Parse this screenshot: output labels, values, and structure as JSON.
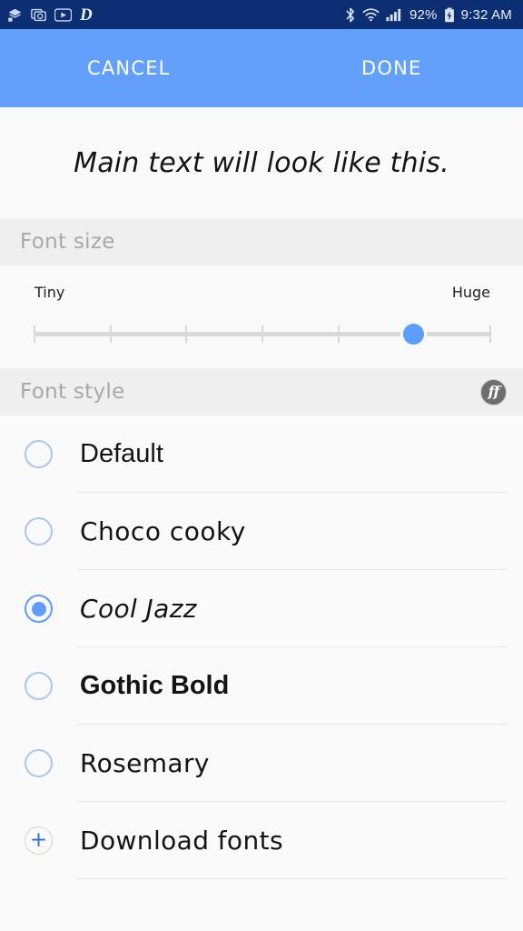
{
  "status_bar": {
    "background": "#0b2f72",
    "left_icons": [
      {
        "name": "downloads-stack-icon",
        "glyph": "☰"
      },
      {
        "name": "screenshot-capture-icon",
        "glyph": "▣"
      },
      {
        "name": "youtube-icon",
        "glyph": "▶"
      },
      {
        "name": "app-letter-d-icon",
        "glyph": "D"
      }
    ],
    "bluetooth_icon": "bluetooth-icon",
    "wifi_icon": "wifi-icon",
    "signal_icon": "cellular-signal-icon",
    "battery_percent": "92%",
    "battery_icon": "battery-charging-icon",
    "clock": "9:32 AM"
  },
  "action_bar": {
    "background": "#63a0fb",
    "cancel_label": "CANCEL",
    "done_label": "DONE"
  },
  "preview": {
    "text": "Main text will look like this."
  },
  "font_size_section": {
    "title": "Font size",
    "min_label": "Tiny",
    "max_label": "Huge",
    "steps": 7,
    "value": 5,
    "max_value": 6,
    "thumb_percent": 83,
    "accent": "#5e9dfa",
    "track_color": "#d8d8d8"
  },
  "font_style_section": {
    "title": "Font style",
    "badge_label": "ff",
    "badge_name": "flipfont-badge-icon",
    "items": [
      {
        "label": "Default",
        "style": "style-default",
        "selected": false,
        "kind": "radio"
      },
      {
        "label": "Choco cooky",
        "style": "style-choco",
        "selected": false,
        "kind": "radio"
      },
      {
        "label": "Cool Jazz",
        "style": "style-cooljazz",
        "selected": true,
        "kind": "radio"
      },
      {
        "label": "Gothic Bold",
        "style": "style-gothic",
        "selected": false,
        "kind": "radio"
      },
      {
        "label": "Rosemary",
        "style": "style-rosemary",
        "selected": false,
        "kind": "radio"
      },
      {
        "label": "Download fonts",
        "style": "style-download",
        "selected": false,
        "kind": "plus"
      }
    ]
  },
  "colors": {
    "accent": "#5e9dfa",
    "status_bar": "#0b2f72",
    "action_bar": "#63a0fb",
    "section_header": "#efefef",
    "page_background": "#fafafa",
    "divider": "#e6e6e6"
  }
}
